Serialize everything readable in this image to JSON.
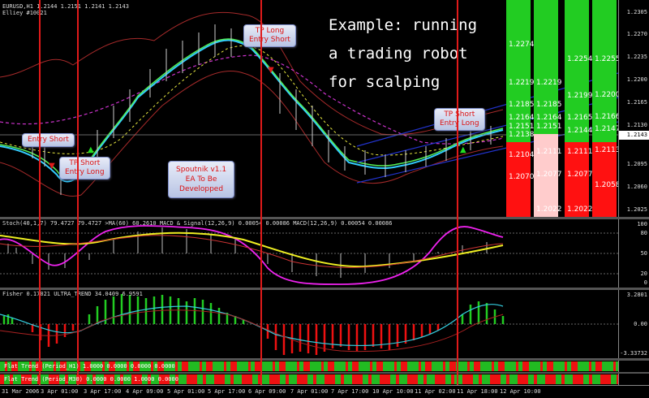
{
  "main": {
    "symbol_line": "EURUSD,H1  1.2144 1.2151 1.2141 1.2143",
    "sub_line": "Elliey #10021",
    "price_ticks": [
      "1.2305",
      "1.2270",
      "1.2235",
      "1.2200",
      "1.2165",
      "1.2130",
      "1.2095",
      "1.2060",
      "1.2025"
    ],
    "current_price": "1.2143",
    "headline": [
      "Example: running",
      "a trading robot",
      "for scalping"
    ],
    "callouts": {
      "entry_short_1": "Entry Short",
      "tp_short_1": "TP Short",
      "entry_long_1": "Entry Long",
      "tp_long": "TP Long",
      "entry_short_2": "Entry Short",
      "tp_short_2": "TP Short",
      "entry_long_2": "Entry Long"
    },
    "spoutnik": [
      "Spoutnik v1.1",
      "EA To Be",
      "Developped"
    ],
    "levels": {
      "col1": [
        "1.2274",
        "1.2219",
        "1.2185",
        "1.2164",
        "1.2151",
        "1.2138",
        "1.2104",
        "1.2070"
      ],
      "col2": [
        "1.2219",
        "1.2185",
        "1.2164",
        "1.2151",
        "1.2111",
        "1.2077",
        "1.2022"
      ],
      "col3": [
        "1.2254",
        "1.2199",
        "1.2165",
        "1.2144",
        "1.2111",
        "1.2077",
        "1.2022"
      ],
      "col4": [
        "1.2255",
        "1.2200",
        "1.2166",
        "1.2147",
        "1.2113",
        "1.2058"
      ]
    }
  },
  "stoch": {
    "title": "Stoch(40,1,7) 79.4727 79.4727  >MA(60) 60.2610  MACD & Signal(12,26,9) 0.00054 0.00086  MACD(12,26,9) 0.00054 0.00086",
    "ticks": [
      "100",
      "80",
      "50",
      "20",
      "0"
    ]
  },
  "fisher": {
    "title": "Fisher 0.17021  ULTRA_TREND 34.0409 6.9591",
    "ticks": [
      "3.2801",
      "0.00",
      "-3.33732"
    ]
  },
  "flat": {
    "row1": "Flat Trend (Period_H1) 1.0000 0.0000 0.0000 0.0000",
    "row2": "Flat Trend (Period_M30) 0.0000 0.0000 1.0000 0.0000"
  },
  "time_axis": [
    "31 Mar 2006",
    "3 Apr 01:00",
    "3 Apr 17:00",
    "4 Apr 09:00",
    "5 Apr 01:00",
    "5 Apr 17:00",
    "6 Apr 09:00",
    "7 Apr 01:00",
    "7 Apr 17:00",
    "10 Apr 10:00",
    "11 Apr 02:00",
    "11 Apr 18:00",
    "12 Apr 10:00"
  ],
  "colors": {
    "signal_line": "#e01a1a",
    "green_band": "#22cc22",
    "red_band": "#ff1111",
    "callout_text": "#dd1111"
  }
}
